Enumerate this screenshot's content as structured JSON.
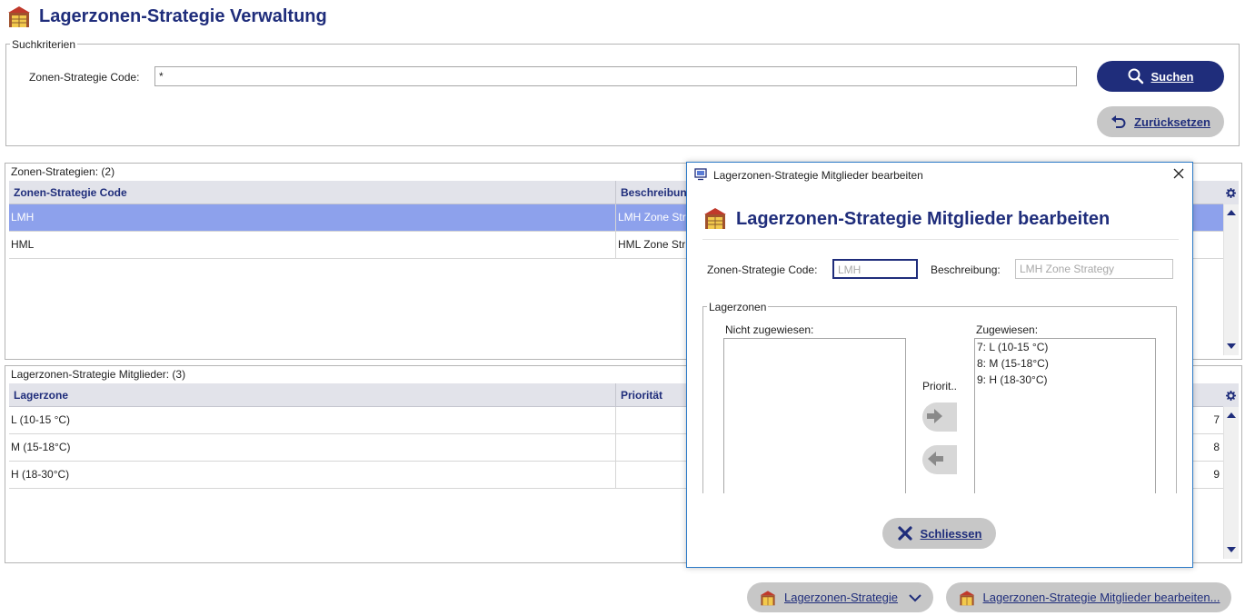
{
  "app": {
    "title": "Lagerzonen-Strategie Verwaltung"
  },
  "search": {
    "legend": "Suchkriterien",
    "code_label": "Zonen-Strategie Code:",
    "code_value": "*",
    "search_button": "Suchen",
    "reset_button": "Zurücksetzen"
  },
  "strategies": {
    "caption": "Zonen-Strategien: (2)",
    "columns": [
      "Zonen-Strategie Code",
      "Beschreibung"
    ],
    "rows": [
      {
        "code": "LMH",
        "description": "LMH Zone Str"
      },
      {
        "code": "HML",
        "description": "HML Zone Str"
      }
    ]
  },
  "members": {
    "caption": "Lagerzonen-Strategie Mitglieder: (3)",
    "columns": [
      "Lagerzone",
      "Priorität"
    ],
    "rows": [
      {
        "zone": "L (10-15 °C)",
        "priority": "7"
      },
      {
        "zone": "M (15-18°C)",
        "priority": "8"
      },
      {
        "zone": "H (18-30°C)",
        "priority": "9"
      }
    ]
  },
  "dialog": {
    "window_title": "Lagerzonen-Strategie Mitglieder bearbeiten",
    "heading": "Lagerzonen-Strategie Mitglieder bearbeiten",
    "code_label": "Zonen-Strategie Code:",
    "code_value": "LMH",
    "description_label": "Beschreibung:",
    "description_value": "LMH Zone Strategy",
    "group_legend": "Lagerzonen",
    "unassigned_label": "Nicht zugewiesen:",
    "assigned_label": "Zugewiesen:",
    "priority_label": "Priorit..",
    "assigned_items": [
      "7: L (10-15 °C)",
      "8: M (15-18°C)",
      "9: H (18-30°C)"
    ],
    "close_button": "Schliessen"
  },
  "footer": {
    "strategy_button": "Lagerzonen-Strategie",
    "members_button": "Lagerzonen-Strategie Mitglieder bearbeiten..."
  },
  "colors": {
    "brand": "#1f2d7b",
    "selected_row": "#8da1ec",
    "header_bg": "#e2e3ea",
    "secondary_button": "#c7c7c7"
  }
}
